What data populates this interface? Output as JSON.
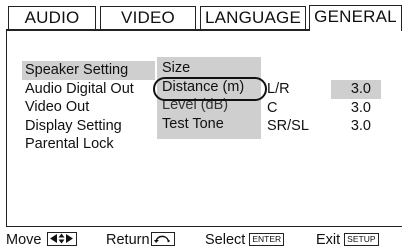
{
  "tabs": [
    {
      "label": "AUDIO"
    },
    {
      "label": "VIDEO"
    },
    {
      "label": "LANGUAGE"
    },
    {
      "label": "GENERAL"
    }
  ],
  "menu": {
    "items": [
      {
        "label": "Speaker Setting"
      },
      {
        "label": "Audio Digital Out"
      },
      {
        "label": "Video Out"
      },
      {
        "label": "Display Setting"
      },
      {
        "label": "Parental Lock"
      }
    ]
  },
  "submenu": {
    "items": [
      {
        "label": "Size"
      },
      {
        "label": "Distance (m)"
      },
      {
        "label": "Level (dB)"
      },
      {
        "label": "Test Tone"
      }
    ]
  },
  "values": [
    {
      "label": "L/R",
      "value": "3.0"
    },
    {
      "label": "C",
      "value": "3.0"
    },
    {
      "label": "SR/SL",
      "value": "3.0"
    }
  ],
  "footer": {
    "move": "Move",
    "return": "Return",
    "select": "Select",
    "select_key": "ENTER",
    "exit": "Exit",
    "exit_key": "SETUP"
  }
}
